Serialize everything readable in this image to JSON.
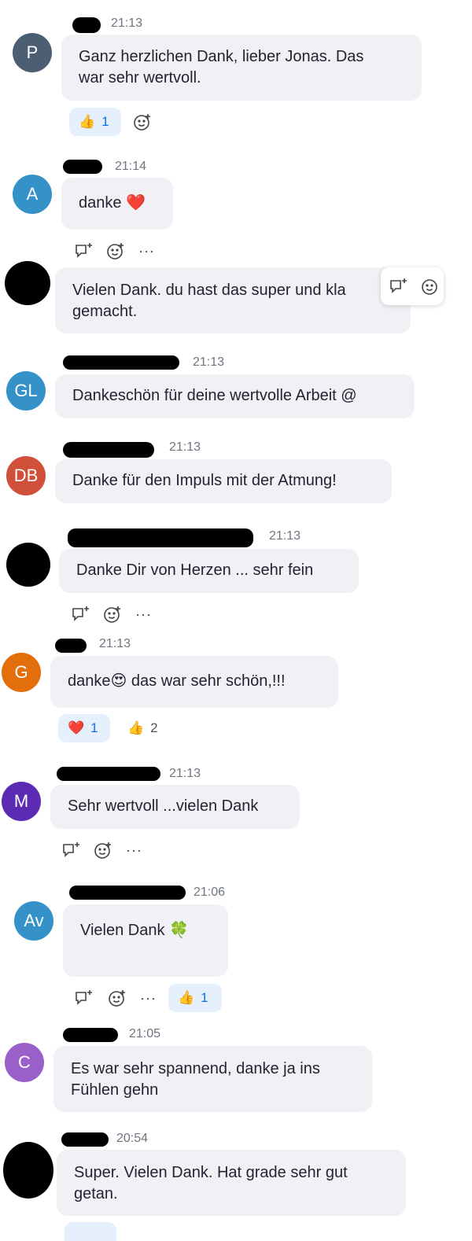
{
  "colors": {
    "bubble": "#f1f1f5",
    "accent": "#0e71eb",
    "avatar_p": "#4b5e72",
    "avatar_a": "#3592c9",
    "avatar_gl": "#3592c9",
    "avatar_db": "#d0503a",
    "avatar_g": "#e36f0c",
    "avatar_m": "#5b2bb4",
    "avatar_av": "#3592c9",
    "avatar_c": "#9a60c9"
  },
  "messages": [
    {
      "initials": "P",
      "time": "21:13",
      "text": "Ganz herzlichen Dank, lieber Jonas. Das\nwar sehr wertvoll.",
      "reactions": [
        {
          "emoji": "👍",
          "count": "1"
        }
      ]
    },
    {
      "initials": "A",
      "time": "21:14",
      "text": "danke ❤️"
    },
    {
      "initials": "",
      "time": "",
      "text": "Vielen Dank. du hast das super und kla\ngemacht."
    },
    {
      "initials": "GL",
      "time": "21:13",
      "text": "Dankeschön für deine wertvolle Arbeit @"
    },
    {
      "initials": "DB",
      "time": "21:13",
      "text": "Danke für den Impuls mit der Atmung!"
    },
    {
      "initials": "",
      "time": "21:13",
      "text": "Danke Dir von Herzen ... sehr fein"
    },
    {
      "initials": "G",
      "time": "21:13",
      "text": "danke😍 das war sehr schön,!!!",
      "reactions": [
        {
          "emoji": "❤️",
          "count": "1"
        },
        {
          "emoji": "👍",
          "count": "2"
        }
      ]
    },
    {
      "initials": "M",
      "time": "21:13",
      "text": "Sehr wertvoll ...vielen Dank"
    },
    {
      "initials": "Av",
      "time": "21:06",
      "text": "Vielen Dank 🍀",
      "reactions": [
        {
          "emoji": "👍",
          "count": "1"
        }
      ]
    },
    {
      "initials": "C",
      "time": "21:05",
      "text": "Es war sehr spannend, danke ja ins\nFühlen gehn"
    },
    {
      "initials": "",
      "time": "20:54",
      "text": "Super. Vielen Dank. Hat grade sehr gut\ngetan."
    }
  ],
  "more_label": "···"
}
